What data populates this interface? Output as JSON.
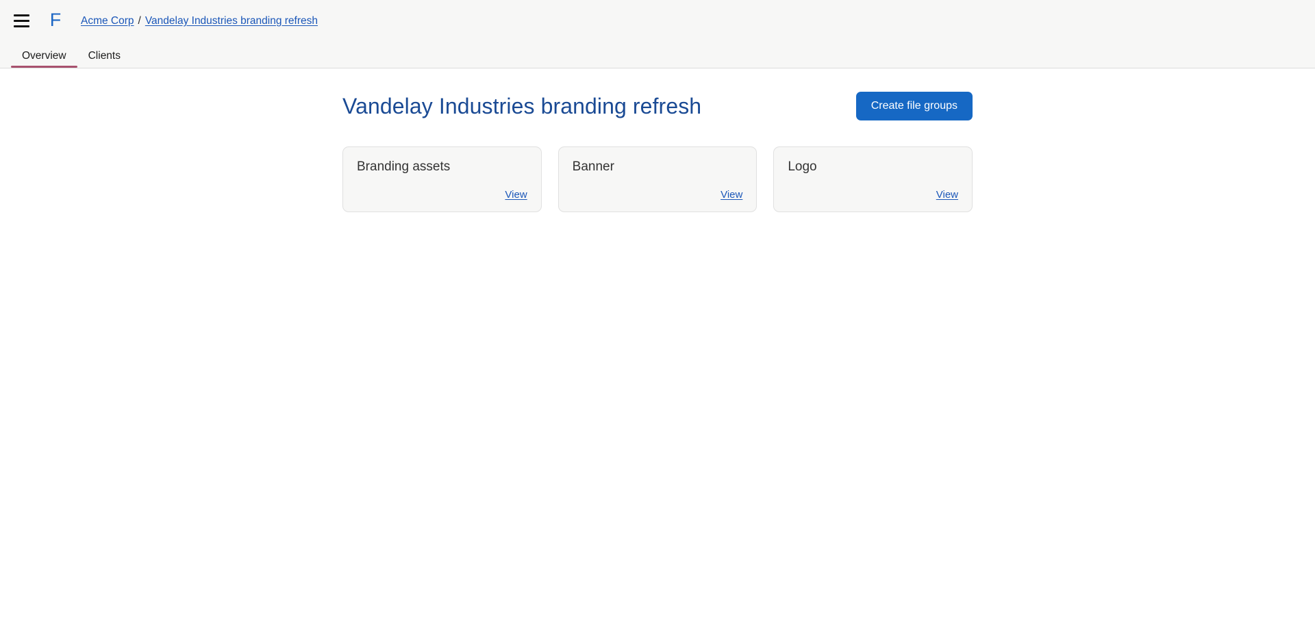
{
  "header": {
    "menu_icon": "hamburger-menu-icon",
    "logo_text": "F",
    "breadcrumb": {
      "root_label": "Acme Corp",
      "separator": "/",
      "current_label": "Vandelay Industries branding refresh"
    },
    "tabs": [
      {
        "label": "Overview",
        "active": true
      },
      {
        "label": "Clients",
        "active": false
      }
    ]
  },
  "main": {
    "page_title": "Vandelay Industries branding refresh",
    "primary_action_label": "Create file groups",
    "file_groups": [
      {
        "title": "Branding assets",
        "view_label": "View"
      },
      {
        "title": "Banner",
        "view_label": "View"
      },
      {
        "title": "Logo",
        "view_label": "View"
      }
    ]
  },
  "colors": {
    "brand_blue": "#1c66c4",
    "link_blue": "#1a56b8",
    "title_blue": "#1a4a94",
    "button_blue": "#1668c4",
    "active_tab_underline": "#a8526e",
    "header_bg": "#f7f7f6",
    "card_bg": "#f7f7f6",
    "card_border": "#e0e0e0"
  }
}
